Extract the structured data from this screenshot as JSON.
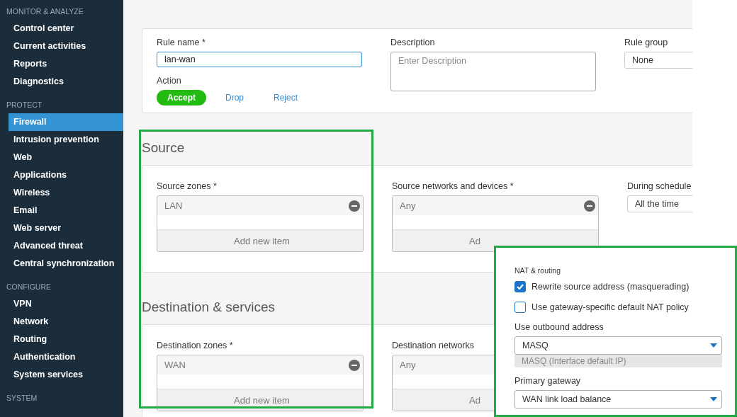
{
  "sidebar": [
    {
      "title": "MONITOR & ANALYZE",
      "items": [
        {
          "label": "Control center",
          "selected": false
        },
        {
          "label": "Current activities",
          "selected": false
        },
        {
          "label": "Reports",
          "selected": false
        },
        {
          "label": "Diagnostics",
          "selected": false
        }
      ]
    },
    {
      "title": "PROTECT",
      "items": [
        {
          "label": "Firewall",
          "selected": true
        },
        {
          "label": "Intrusion prevention",
          "selected": false
        },
        {
          "label": "Web",
          "selected": false
        },
        {
          "label": "Applications",
          "selected": false
        },
        {
          "label": "Wireless",
          "selected": false
        },
        {
          "label": "Email",
          "selected": false
        },
        {
          "label": "Web server",
          "selected": false
        },
        {
          "label": "Advanced threat",
          "selected": false
        },
        {
          "label": "Central synchronization",
          "selected": false
        }
      ]
    },
    {
      "title": "CONFIGURE",
      "items": [
        {
          "label": "VPN",
          "selected": false
        },
        {
          "label": "Network",
          "selected": false
        },
        {
          "label": "Routing",
          "selected": false
        },
        {
          "label": "Authentication",
          "selected": false
        },
        {
          "label": "System services",
          "selected": false
        }
      ]
    },
    {
      "title": "SYSTEM"
    }
  ],
  "rule": {
    "name_label": "Rule name *",
    "name_value": "lan-wan",
    "action_label": "Action",
    "actions": [
      {
        "label": "Accept",
        "selected": true
      },
      {
        "label": "Drop",
        "selected": false
      },
      {
        "label": "Reject",
        "selected": false
      }
    ],
    "description_label": "Description",
    "description_placeholder": "Enter Description",
    "group_label": "Rule group",
    "group_value": "None"
  },
  "sections": [
    {
      "title": "Source",
      "fields": [
        {
          "kind": "list",
          "label": "Source zones *",
          "items": [
            "LAN"
          ],
          "add": "Add new item"
        },
        {
          "kind": "list",
          "label": "Source networks and devices *",
          "items": [
            "Any"
          ],
          "add": "Ad"
        },
        {
          "kind": "select",
          "label": "During schedule",
          "value": "All the time"
        }
      ]
    },
    {
      "title": "Destination & services",
      "fields": [
        {
          "kind": "list",
          "label": "Destination zones *",
          "items": [
            "WAN"
          ],
          "add": "Add new item"
        },
        {
          "kind": "list",
          "label": "Destination networks",
          "items": [
            "Any"
          ],
          "add": "Ad"
        }
      ]
    }
  ],
  "nat": {
    "title": "NAT & routing",
    "options": [
      {
        "label": "Rewrite source address (masquerading)",
        "checked": true
      },
      {
        "label": "Use gateway-specific default NAT policy",
        "checked": false
      }
    ],
    "outbound_label": "Use outbound address",
    "outbound_value": "MASQ",
    "outbound_option": "MASQ (Interface default IP)",
    "gateway_label": "Primary gateway",
    "gateway_value": "WAN link load balance"
  }
}
